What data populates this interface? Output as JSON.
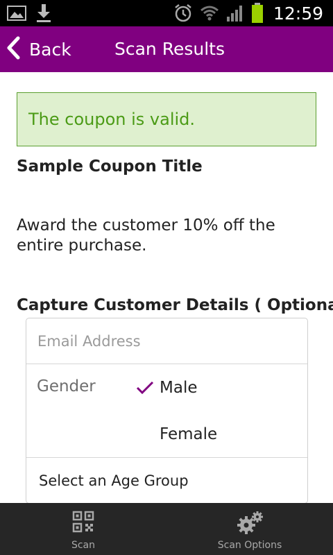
{
  "status_bar": {
    "time": "12:59",
    "icons": [
      "image-notification-icon",
      "download-icon",
      "alarm-icon",
      "wifi-icon",
      "signal-icon",
      "battery-icon"
    ]
  },
  "action_bar": {
    "back_label": "Back",
    "title": "Scan Results",
    "color": "#800080"
  },
  "result": {
    "status_message": "The coupon is valid.",
    "status_color": "#4b9b16",
    "coupon_title": "Sample Coupon Title",
    "coupon_description": "Award the customer 10% off the entire purchase."
  },
  "customer_details": {
    "header": "Capture Customer Details ( Optional )",
    "email_placeholder": "Email Address",
    "email_value": "",
    "gender_label": "Gender",
    "gender_options": [
      {
        "label": "Male",
        "selected": true
      },
      {
        "label": "Female",
        "selected": false
      }
    ],
    "age_group_label": "Select an Age Group"
  },
  "bottom_nav": {
    "items": [
      {
        "label": "Scan",
        "icon": "qr-code-icon"
      },
      {
        "label": "Scan Options",
        "icon": "gears-icon"
      }
    ]
  }
}
